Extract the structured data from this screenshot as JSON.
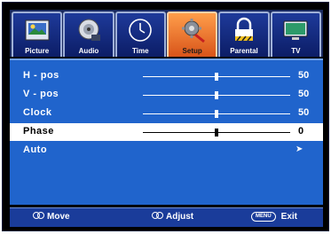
{
  "tabs": [
    {
      "label": "Picture",
      "icon": "picture-icon",
      "active": false
    },
    {
      "label": "Audio",
      "icon": "audio-icon",
      "active": false
    },
    {
      "label": "Time",
      "icon": "clock-icon",
      "active": false
    },
    {
      "label": "Setup",
      "icon": "setup-gear-icon",
      "active": true
    },
    {
      "label": "Parental",
      "icon": "lock-icon",
      "active": false
    },
    {
      "label": "TV",
      "icon": "tv-icon",
      "active": false
    }
  ],
  "settings": [
    {
      "label": "H - pos",
      "value": "50",
      "slider_fraction": 0.5
    },
    {
      "label": "V - pos",
      "value": "50",
      "slider_fraction": 0.5
    },
    {
      "label": "Clock",
      "value": "50",
      "slider_fraction": 0.5
    },
    {
      "label": "Phase",
      "value": "0",
      "slider_fraction": 0.5,
      "selected": true
    },
    {
      "label": "Auto",
      "action_icon": "arrow-right-icon"
    }
  ],
  "help_bar": {
    "move_label": "Move",
    "adjust_label": "Adjust",
    "menu_key": "MENU",
    "exit_label": "Exit"
  },
  "colors": {
    "panel_bg": "#2064cc",
    "active_tab": "#f07a2e",
    "selected_row": "#ffffff"
  }
}
